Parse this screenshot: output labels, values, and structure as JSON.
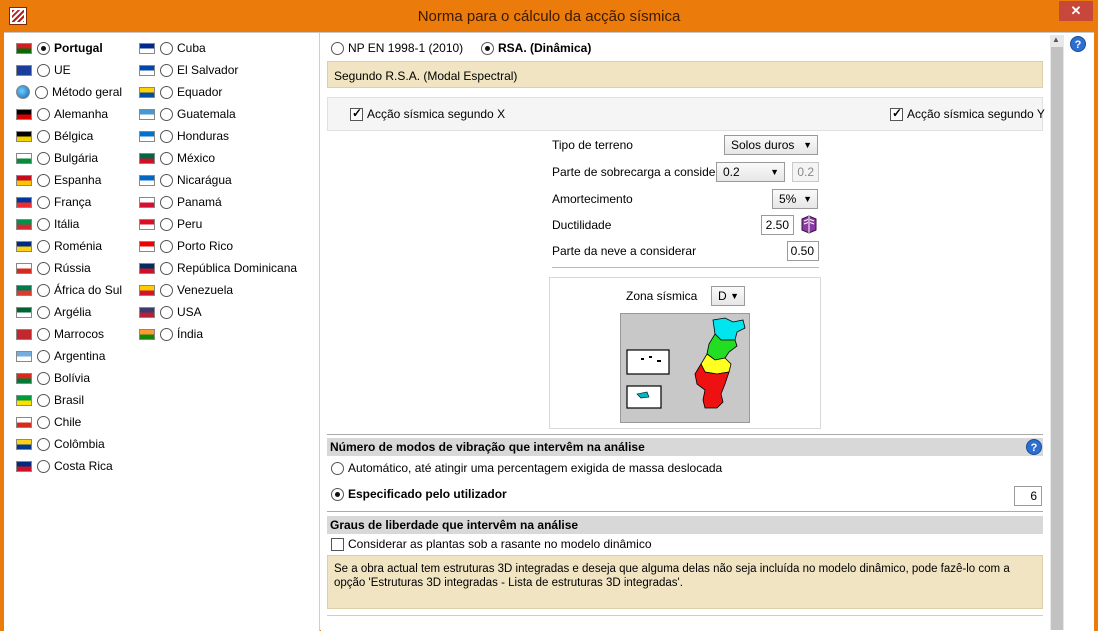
{
  "window": {
    "title": "Norma para o cálculo da acção sísmica",
    "close": "✕"
  },
  "countries_col1": [
    {
      "label": "Portugal",
      "selected": true,
      "bold": true,
      "flag": "#d11f1f|#066a06"
    },
    {
      "label": "UE",
      "flag": "#1a3c9a|#1a3c9a"
    },
    {
      "label": "Método geral",
      "flag": "globe"
    },
    {
      "label": "Alemanha",
      "flag": "#000|#d00"
    },
    {
      "label": "Bélgica",
      "flag": "#000|#f4d000"
    },
    {
      "label": "Bulgária",
      "flag": "#fff|#0a8a3a"
    },
    {
      "label": "Espanha",
      "flag": "#c60b1e|#ffc400"
    },
    {
      "label": "França",
      "flag": "#0035a0|#ef2b2d"
    },
    {
      "label": "Itália",
      "flag": "#009246|#ce2b37"
    },
    {
      "label": "Roménia",
      "flag": "#002b7f|#fcd116"
    },
    {
      "label": "Rússia",
      "flag": "#fff|#d52b1e"
    },
    {
      "label": "África do Sul",
      "flag": "#007a4d|#de3831"
    },
    {
      "label": "Argélia",
      "flag": "#006233|#fff"
    },
    {
      "label": "Marrocos",
      "flag": "#c1272d|#c1272d"
    },
    {
      "label": "Argentina",
      "flag": "#74acdf|#fff"
    },
    {
      "label": "Bolívia",
      "flag": "#d52b1e|#007934"
    },
    {
      "label": "Brasil",
      "flag": "#009c3b|#ffdf00"
    },
    {
      "label": "Chile",
      "flag": "#fff|#d52b1e"
    },
    {
      "label": "Colômbia",
      "flag": "#fcd116|#003893"
    },
    {
      "label": "Costa Rica",
      "flag": "#002b7f|#ce1126"
    }
  ],
  "countries_col2": [
    {
      "label": "Cuba",
      "flag": "#002a8f|#fff"
    },
    {
      "label": "El Salvador",
      "flag": "#0047ab|#fff"
    },
    {
      "label": "Equador",
      "flag": "#ffd100|#034ea2"
    },
    {
      "label": "Guatemala",
      "flag": "#4997d0|#fff"
    },
    {
      "label": "Honduras",
      "flag": "#0073cf|#fff"
    },
    {
      "label": "México",
      "flag": "#006847|#ce1126"
    },
    {
      "label": "Nicarágua",
      "flag": "#0067c6|#fff"
    },
    {
      "label": "Panamá",
      "flag": "#fff|#d21034"
    },
    {
      "label": "Peru",
      "flag": "#d91023|#fff"
    },
    {
      "label": "Porto Rico",
      "flag": "#ed0000|#fff"
    },
    {
      "label": "República Dominicana",
      "flag": "#002d62|#ce1126"
    },
    {
      "label": "Venezuela",
      "flag": "#ffcc00|#cf142b"
    },
    {
      "label": "USA",
      "flag": "#3c3b6e|#b22234"
    },
    {
      "label": "Índia",
      "flag": "#ff9933|#138808"
    }
  ],
  "standard": {
    "option1": "NP EN 1998-1 (2010)",
    "option2": "RSA. (Dinâmica)",
    "info": "Segundo R.S.A. (Modal Espectral)"
  },
  "seismic": {
    "x_label": "Acção sísmica segundo X",
    "y_label": "Acção sísmica segundo Y"
  },
  "params": {
    "terreno_label": "Tipo de terreno",
    "terreno_value": "Solos duros",
    "sobrecarga_label": "Parte de sobrecarga a considerar",
    "sobrecarga_value": "0.2",
    "sobrecarga_extra": "0.2",
    "amort_label": "Amortecimento",
    "amort_value": "5%",
    "duct_label": "Ductilidade",
    "duct_value": "2.50",
    "neve_label": "Parte da neve a considerar",
    "neve_value": "0.50"
  },
  "zona": {
    "label": "Zona sísmica",
    "value": "D"
  },
  "modes": {
    "title": "Número de modos de vibração que intervêm na análise",
    "auto": "Automático, até atingir uma percentagem exigida de massa deslocada",
    "specified": "Especificado pelo utilizador",
    "count": "6"
  },
  "dof": {
    "title": "Graus de liberdade que intervêm na análise",
    "checkbox": "Considerar as plantas sob a rasante no modelo dinâmico",
    "info": "Se a obra actual tem estruturas 3D integradas e deseja que alguma delas não seja incluída no modelo dinâmico, pode fazê-lo com a opção 'Estruturas 3D integradas - Lista de estruturas 3D integradas'."
  },
  "help": "?",
  "colors": {
    "titlebar": "#eb7b0a",
    "info": "#f0e4c3",
    "help": "#2c6fd0"
  }
}
